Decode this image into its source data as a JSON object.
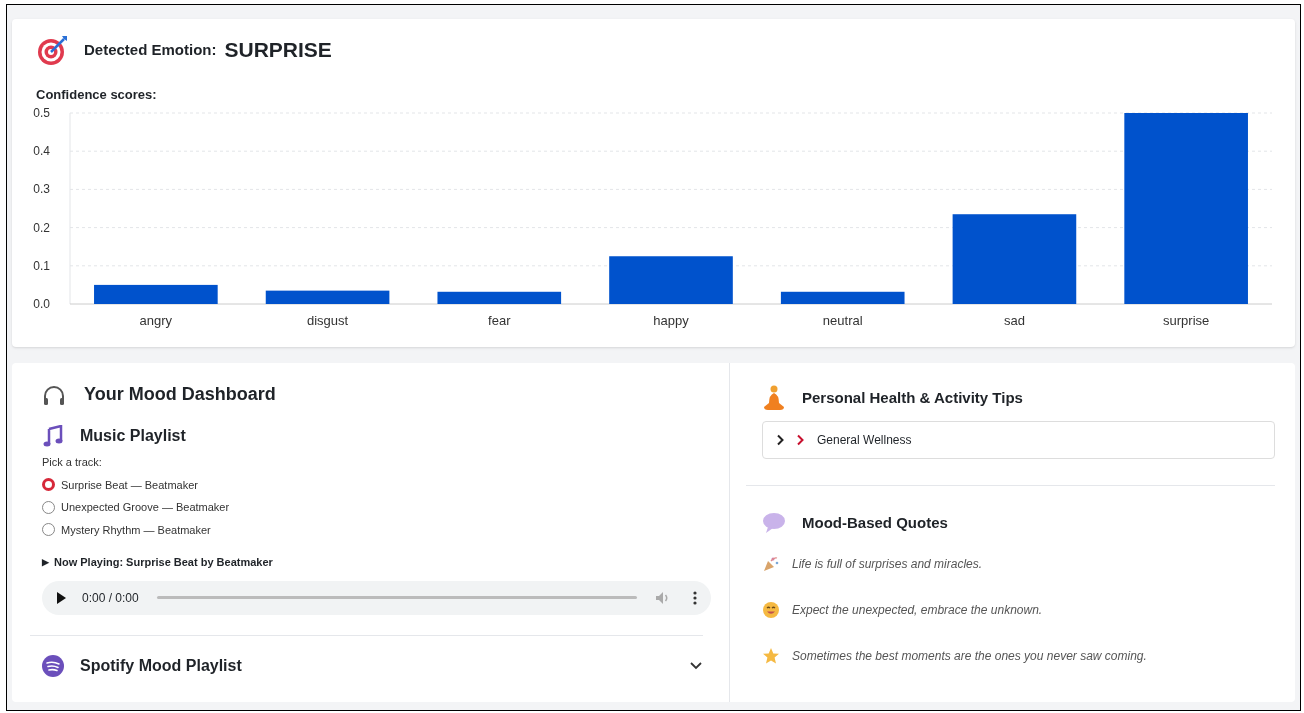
{
  "detected": {
    "label": "Detected Emotion:",
    "value": "SURPRISE"
  },
  "confidence": {
    "title": "Confidence scores:",
    "chart_data": {
      "type": "bar",
      "categories": [
        "angry",
        "disgust",
        "fear",
        "happy",
        "neutral",
        "sad",
        "surprise"
      ],
      "grid": true,
      "series": [
        {
          "color": "#0052cc",
          "values": [
            0.05,
            0.035,
            0.032,
            0.125,
            0.032,
            0.235,
            0.5
          ]
        }
      ],
      "ylim": [
        0,
        0.5
      ],
      "yticks": [
        {
          "value": 0,
          "label": "0.0"
        },
        {
          "value": 0.1,
          "label": "0.1"
        },
        {
          "value": 0.2,
          "label": "0.2"
        },
        {
          "value": 0.3,
          "label": "0.3"
        },
        {
          "value": 0.4,
          "label": "0.4"
        },
        {
          "value": 0.5,
          "label": "0.5"
        }
      ]
    }
  },
  "dashboard": {
    "title": "Your Mood Dashboard",
    "playlist": {
      "title": "Music Playlist",
      "prompt": "Pick a track:",
      "tracks": [
        {
          "label": "Surprise Beat — Beatmaker",
          "selected": true
        },
        {
          "label": "Unexpected Groove — Beatmaker",
          "selected": false
        },
        {
          "label": "Mystery Rhythm — Beatmaker",
          "selected": false
        }
      ],
      "now_playing": {
        "marker": "▶",
        "label": "Now Playing: Surprise Beat by Beatmaker"
      },
      "player": {
        "time": "0:00 / 0:00"
      }
    },
    "spotify": {
      "title": "Spotify Mood Playlist",
      "expanded": false
    }
  },
  "tips": {
    "title": "Personal Health & Activity Tips",
    "items": [
      {
        "label": "General Wellness",
        "expanded": false
      }
    ]
  },
  "quotes": {
    "title": "Mood-Based Quotes",
    "items": [
      {
        "kind": "party",
        "text": "Life is full of surprises and miracles."
      },
      {
        "kind": "smile",
        "text": "Expect the unexpected, embrace the unknown."
      },
      {
        "kind": "star",
        "text": "Sometimes the best moments are the ones you never saw coming."
      }
    ]
  }
}
